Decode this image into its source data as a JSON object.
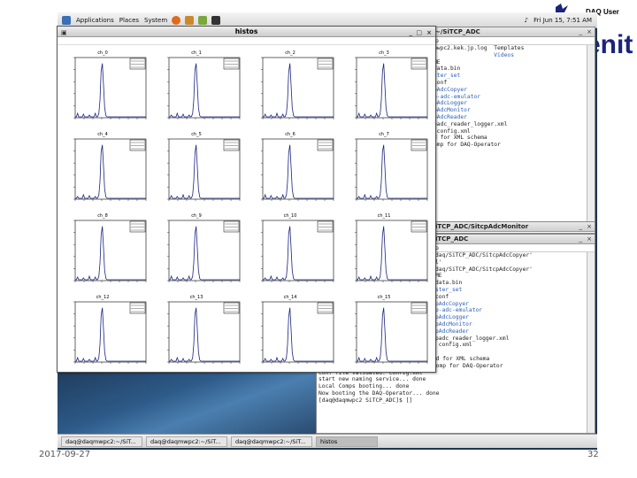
{
  "topbar": {
    "menus": [
      "Applications",
      "Places",
      "System"
    ],
    "clock": "Fri Jun 15, 7:51 AM",
    "user": "DAQ User"
  },
  "term_top": {
    "title": "~/SiTCP_ADC",
    "menu": "p",
    "lines": [
      {
        "t": "mwpc2.kek.jp.log  Templates",
        "c": "mix"
      },
      {
        "t": "                  Videos",
        "c": "blue"
      },
      {
        "t": "",
        "c": ""
      },
      {
        "t": "ME",
        "c": ""
      },
      {
        "t": "data.bin",
        "c": ""
      },
      {
        "t": "ster_set",
        "c": "blue"
      },
      {
        "t": "conf",
        "c": ""
      },
      {
        "t": "pAdcCopyer",
        "c": "blue"
      },
      {
        "t": "p-adc-emulator",
        "c": "blue"
      },
      {
        "t": "pAdcLogger",
        "c": "blue"
      },
      {
        "t": "pAdcMonitor",
        "c": "blue"
      },
      {
        "t": "pAdcReader",
        "c": "blue"
      },
      {
        "t": "padc_reader_logger.xml",
        "c": ""
      },
      {
        "t": "",
        "c": ""
      },
      {
        "t": " config.xml",
        "c": ""
      },
      {
        "t": "",
        "c": ""
      },
      {
        "t": "d for XML schema",
        "c": ""
      },
      {
        "t": "omp for DAQ-Operator",
        "c": ""
      }
    ]
  },
  "term_monitor": {
    "title": "iTCP_ADC/SitcpAdcMonitor"
  },
  "term_main": {
    "title": "iTCP_ADC",
    "menu": "p",
    "lines": [
      {
        "t": "daq/SiTCP_ADC/SitcpAdcCopyer'",
        "c": ""
      },
      {
        "t": "l'",
        "c": ""
      },
      {
        "t": "daq/SiTCP_ADC/SitcpAdcCopyer'",
        "c": ""
      },
      {
        "t": "",
        "c": ""
      },
      {
        "t": "ME",
        "c": ""
      },
      {
        "t": "data.bin",
        "c": ""
      },
      {
        "t": "ster_set",
        "c": "blue"
      },
      {
        "t": "conf",
        "c": ""
      },
      {
        "t": "pAdcCopyer",
        "c": "blue"
      },
      {
        "t": "p-adc-emulator",
        "c": "blue"
      },
      {
        "t": "pAdcLogger",
        "c": "blue"
      },
      {
        "t": "pAdcMonitor",
        "c": "blue"
      },
      {
        "t": "pAdcReader",
        "c": "blue"
      },
      {
        "t": "padc_reader_logger.xml",
        "c": ""
      },
      {
        "t": "",
        "c": ""
      },
      {
        "t": " config.xml",
        "c": ""
      }
    ],
    "tail": [
      "Use config file config.xml",
      "Use /usr/share/daqmw/conf/config.xsd for XML schema",
      "Use /usr/libexec/daqmw/DaqOperatorComp for DAQ-Operator",
      "Conf file validated: config.xml",
      "start new naming service... done",
      "Local Comps booting... done",
      "Now booting the DAQ-Operator... done",
      "[daq@daqmwpc2 SiTCP_ADC]$ []"
    ]
  },
  "histos": {
    "title": "histos",
    "channels": [
      "ch_0",
      "ch_1",
      "ch_2",
      "ch_3",
      "ch_4",
      "ch_5",
      "ch_6",
      "ch_7",
      "ch_8",
      "ch_9",
      "ch_10",
      "ch_11",
      "ch_12",
      "ch_13",
      "ch_14",
      "ch_15"
    ]
  },
  "taskbar": {
    "tasks": [
      {
        "label": "daq@daqmwpc2:~/SiT...",
        "active": false
      },
      {
        "label": "daq@daqmwpc2:~/SiT...",
        "active": false
      },
      {
        "label": "daq@daqmwpc2:~/SiT...",
        "active": false
      },
      {
        "label": "histos",
        "active": true
      }
    ]
  },
  "footer": {
    "date": "2017-09-27",
    "page": "32"
  },
  "logo": {
    "text": "enit"
  },
  "colors": {
    "histo_line": "#1a237e",
    "terminal_blue": "#2a5fb5"
  }
}
